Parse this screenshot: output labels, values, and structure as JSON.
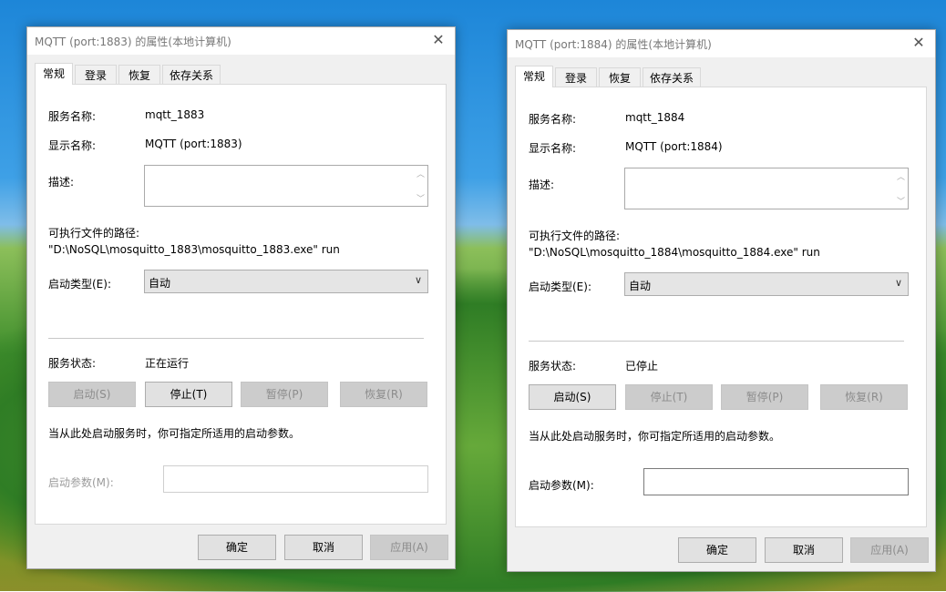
{
  "dialogs": [
    {
      "title": "MQTT (port:1883) 的属性(本地计算机)",
      "tabs": [
        "常规",
        "登录",
        "恢复",
        "依存关系"
      ],
      "service_name_label": "服务名称:",
      "service_name": "mqtt_1883",
      "display_name_label": "显示名称:",
      "display_name": "MQTT (port:1883)",
      "description_label": "描述:",
      "exe_path_label": "可执行文件的路径:",
      "exe_path": "\"D:\\NoSQL\\mosquitto_1883\\mosquitto_1883.exe\" run",
      "startup_type_label": "启动类型(E):",
      "startup_type": "自动",
      "status_label": "服务状态:",
      "status": "正在运行",
      "start_btn": "启动(S)",
      "stop_btn": "停止(T)",
      "pause_btn": "暂停(P)",
      "resume_btn": "恢复(R)",
      "hint": "当从此处启动服务时，你可指定所适用的启动参数。",
      "params_label": "启动参数(M):",
      "ok_btn": "确定",
      "cancel_btn": "取消",
      "apply_btn": "应用(A)"
    },
    {
      "title": "MQTT (port:1884) 的属性(本地计算机)",
      "tabs": [
        "常规",
        "登录",
        "恢复",
        "依存关系"
      ],
      "service_name_label": "服务名称:",
      "service_name": "mqtt_1884",
      "display_name_label": "显示名称:",
      "display_name": "MQTT (port:1884)",
      "description_label": "描述:",
      "exe_path_label": "可执行文件的路径:",
      "exe_path": "\"D:\\NoSQL\\mosquitto_1884\\mosquitto_1884.exe\" run",
      "startup_type_label": "启动类型(E):",
      "startup_type": "自动",
      "status_label": "服务状态:",
      "status": "已停止",
      "start_btn": "启动(S)",
      "stop_btn": "停止(T)",
      "pause_btn": "暂停(P)",
      "resume_btn": "恢复(R)",
      "hint": "当从此处启动服务时，你可指定所适用的启动参数。",
      "params_label": "启动参数(M):",
      "ok_btn": "确定",
      "cancel_btn": "取消",
      "apply_btn": "应用(A)"
    }
  ],
  "icons": {
    "close": "close-icon",
    "dropdown": "chevron-down-icon",
    "scroll_up": "chevron-up-icon",
    "scroll_down": "chevron-down-icon"
  }
}
